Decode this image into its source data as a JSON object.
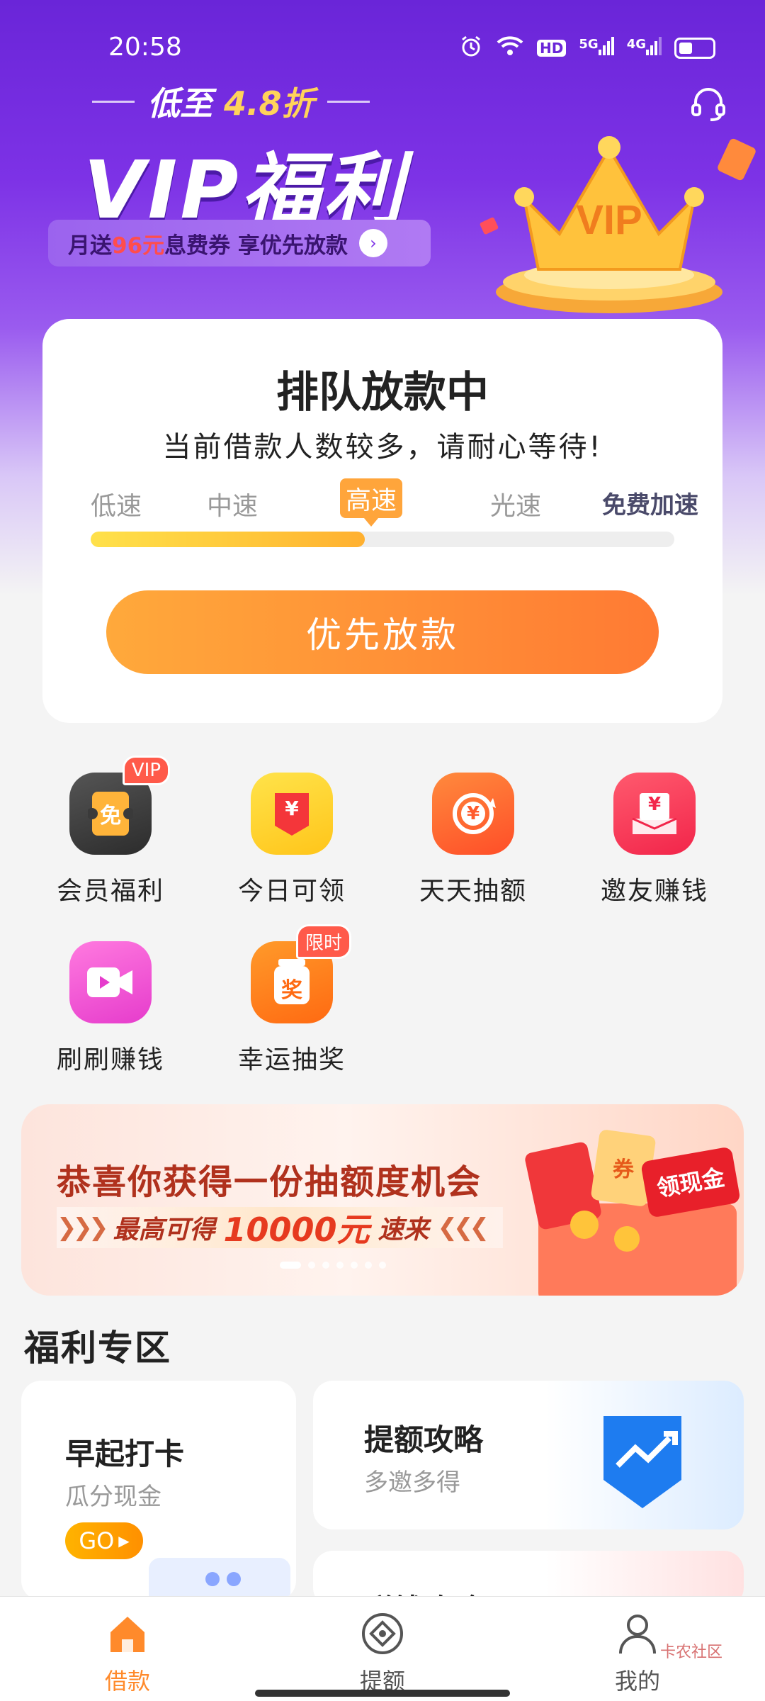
{
  "status_bar": {
    "time": "20:58",
    "icons": [
      "alarm-icon",
      "wifi-icon",
      "hd-icon",
      "5g-signal-icon",
      "4g-signal-icon",
      "battery-icon"
    ],
    "hd": "HD",
    "net5g": "5G",
    "net4g": "4G"
  },
  "promo": {
    "subtitle_prefix": "低至",
    "subtitle_discount": "4.8折",
    "title": "VIP福利",
    "pill_text_a": "月送",
    "pill_amount": "96元",
    "pill_text_b": "息费券 享优先放款",
    "crown_text": "VIP"
  },
  "queue": {
    "title": "排队放款中",
    "description": "当前借款人数较多，请耐心等待!",
    "speeds": [
      "低速",
      "中速",
      "高速",
      "光速"
    ],
    "active_speed": "高速",
    "boost_label": "免费加速",
    "progress_percent": 47,
    "button_label": "优先放款"
  },
  "features": [
    {
      "label": "会员福利",
      "icon": "member-coupon-icon",
      "badge": "VIP",
      "glyph": "免"
    },
    {
      "label": "今日可领",
      "icon": "red-envelope-icon",
      "badge": "",
      "glyph": "¥"
    },
    {
      "label": "天天抽额",
      "icon": "refresh-coin-icon",
      "badge": "",
      "glyph": "¥"
    },
    {
      "label": "邀友赚钱",
      "icon": "invite-money-icon",
      "badge": "",
      "glyph": "¥"
    },
    {
      "label": "刷刷赚钱",
      "icon": "video-icon",
      "badge": "",
      "glyph": ""
    },
    {
      "label": "幸运抽奖",
      "icon": "prize-jar-icon",
      "badge": "限时",
      "glyph": "奖"
    }
  ],
  "banner": {
    "title": "恭喜你获得一份抽额度机会",
    "sub_prefix": "最高可得",
    "amount": "10000元",
    "sub_suffix": "速来",
    "tag": "领现金",
    "coupon": "券"
  },
  "welfare": {
    "section_title": "福利专区",
    "cards": [
      {
        "title": "早起打卡",
        "subtitle": "瓜分现金",
        "button": "GO"
      },
      {
        "title": "提额攻略",
        "subtitle": "多邀多得"
      },
      {
        "title": "赚钱攻略"
      }
    ]
  },
  "nav": {
    "items": [
      {
        "label": "借款",
        "icon": "home-icon",
        "active": true
      },
      {
        "label": "提额",
        "icon": "diamond-target-icon",
        "active": false
      },
      {
        "label": "我的",
        "icon": "user-icon",
        "active": false
      }
    ]
  },
  "watermark": "卡农社区",
  "colors": {
    "brand_purple": "#7d32e6",
    "accent_orange": "#ff8a2b",
    "highlight_yellow": "#ffd35a"
  }
}
